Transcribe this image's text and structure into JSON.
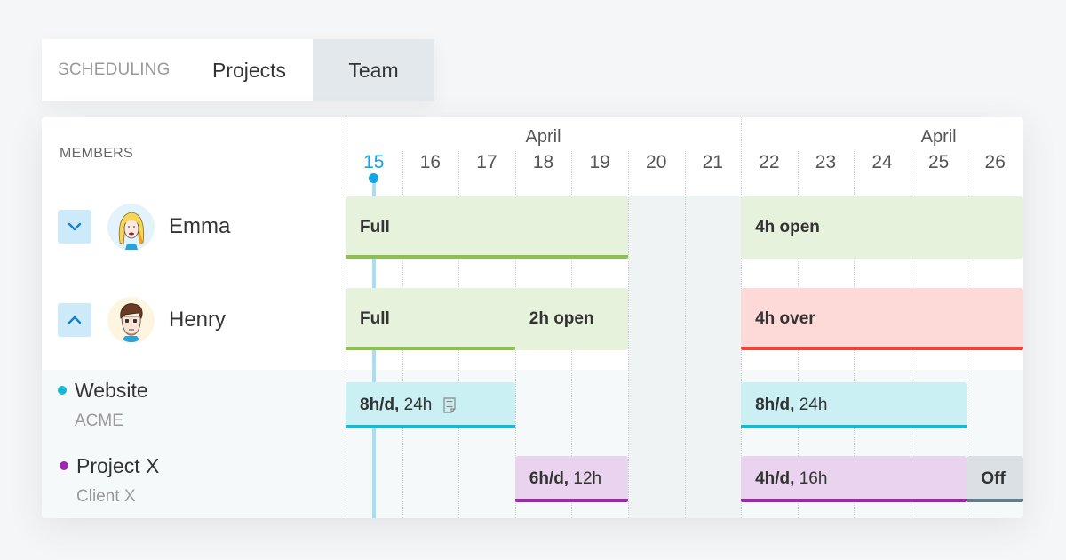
{
  "tabs": {
    "section_label": "SCHEDULING",
    "items": [
      {
        "label": "Projects",
        "active": false
      },
      {
        "label": "Team",
        "active": true
      }
    ]
  },
  "members_header": "MEMBERS",
  "members": [
    {
      "name": "Emma",
      "toggle_icon": "chevron-down-icon",
      "expanded": false
    },
    {
      "name": "Henry",
      "toggle_icon": "chevron-up-icon",
      "expanded": true
    }
  ],
  "projects": [
    {
      "name": "Website",
      "client": "ACME",
      "color": "#16b9d4"
    },
    {
      "name": "Project X",
      "client": "Client X",
      "color": "#9c27b0"
    }
  ],
  "calendar": {
    "month_labels": [
      {
        "label": "April",
        "over_day": "18"
      },
      {
        "label": "April",
        "over_day": "25"
      }
    ],
    "days": [
      "15",
      "16",
      "17",
      "18",
      "19",
      "20",
      "21",
      "22",
      "23",
      "24",
      "25",
      "26"
    ],
    "today": "15",
    "weekend_days": [
      "20",
      "21"
    ]
  },
  "bars": [
    {
      "row": "emma",
      "start": "15",
      "end": "19",
      "label": "Full",
      "bold_part": "Full",
      "rest": "",
      "bg": "#e6f2dc",
      "line": "#8bc34a",
      "line_span_fraction": 1
    },
    {
      "row": "emma",
      "start": "22",
      "end": "26",
      "label": "4h open",
      "bold_part": "4h open",
      "rest": "",
      "bg": "#e6f2dc",
      "line": null
    },
    {
      "row": "henry",
      "start": "15",
      "end": "19",
      "label": "Full",
      "bold_part": "Full",
      "rest": "",
      "bg": "#e6f2dc",
      "line": "#8bc34a",
      "line_span_fraction": 0.6,
      "secondary_label": "2h open"
    },
    {
      "row": "henry",
      "start": "22",
      "end": "26",
      "label": "4h over",
      "bold_part": "4h over",
      "rest": "",
      "bg": "#fdd9d8",
      "line": "#f44336",
      "line_span_fraction": 1
    },
    {
      "row": "website",
      "start": "15",
      "end": "17",
      "label": "8h/d, 24h",
      "bold_part": "8h/d,",
      "rest": " 24h",
      "bg": "#cbf0f4",
      "line": "#16b9d4",
      "line_span_fraction": 1,
      "icon": "note-icon"
    },
    {
      "row": "website",
      "start": "22",
      "end": "25",
      "label": "8h/d, 24h",
      "bold_part": "8h/d,",
      "rest": " 24h",
      "bg": "#cbf0f4",
      "line": "#16b9d4",
      "line_span_fraction": 1
    },
    {
      "row": "projectx",
      "start": "18",
      "end": "19",
      "label": "6h/d, 12h",
      "bold_part": "6h/d,",
      "rest": " 12h",
      "bg": "#ead3ee",
      "line": "#9c27b0",
      "line_span_fraction": 1
    },
    {
      "row": "projectx",
      "start": "22",
      "end": "25",
      "label": "4h/d, 16h",
      "bold_part": "4h/d,",
      "rest": " 16h",
      "bg": "#ead3ee",
      "line": "#9c27b0",
      "line_span_fraction": 1
    },
    {
      "row": "projectx",
      "start": "26",
      "end": "26",
      "label": "Off",
      "bold_part": "Off",
      "rest": "",
      "bg": "#dae0e3",
      "line": "#607d8b",
      "line_span_fraction": 1
    }
  ],
  "colors": {
    "accent": "#13a4e8",
    "toggle_bg": "#cdeafb",
    "active_tab_bg": "#e3e8ed"
  }
}
